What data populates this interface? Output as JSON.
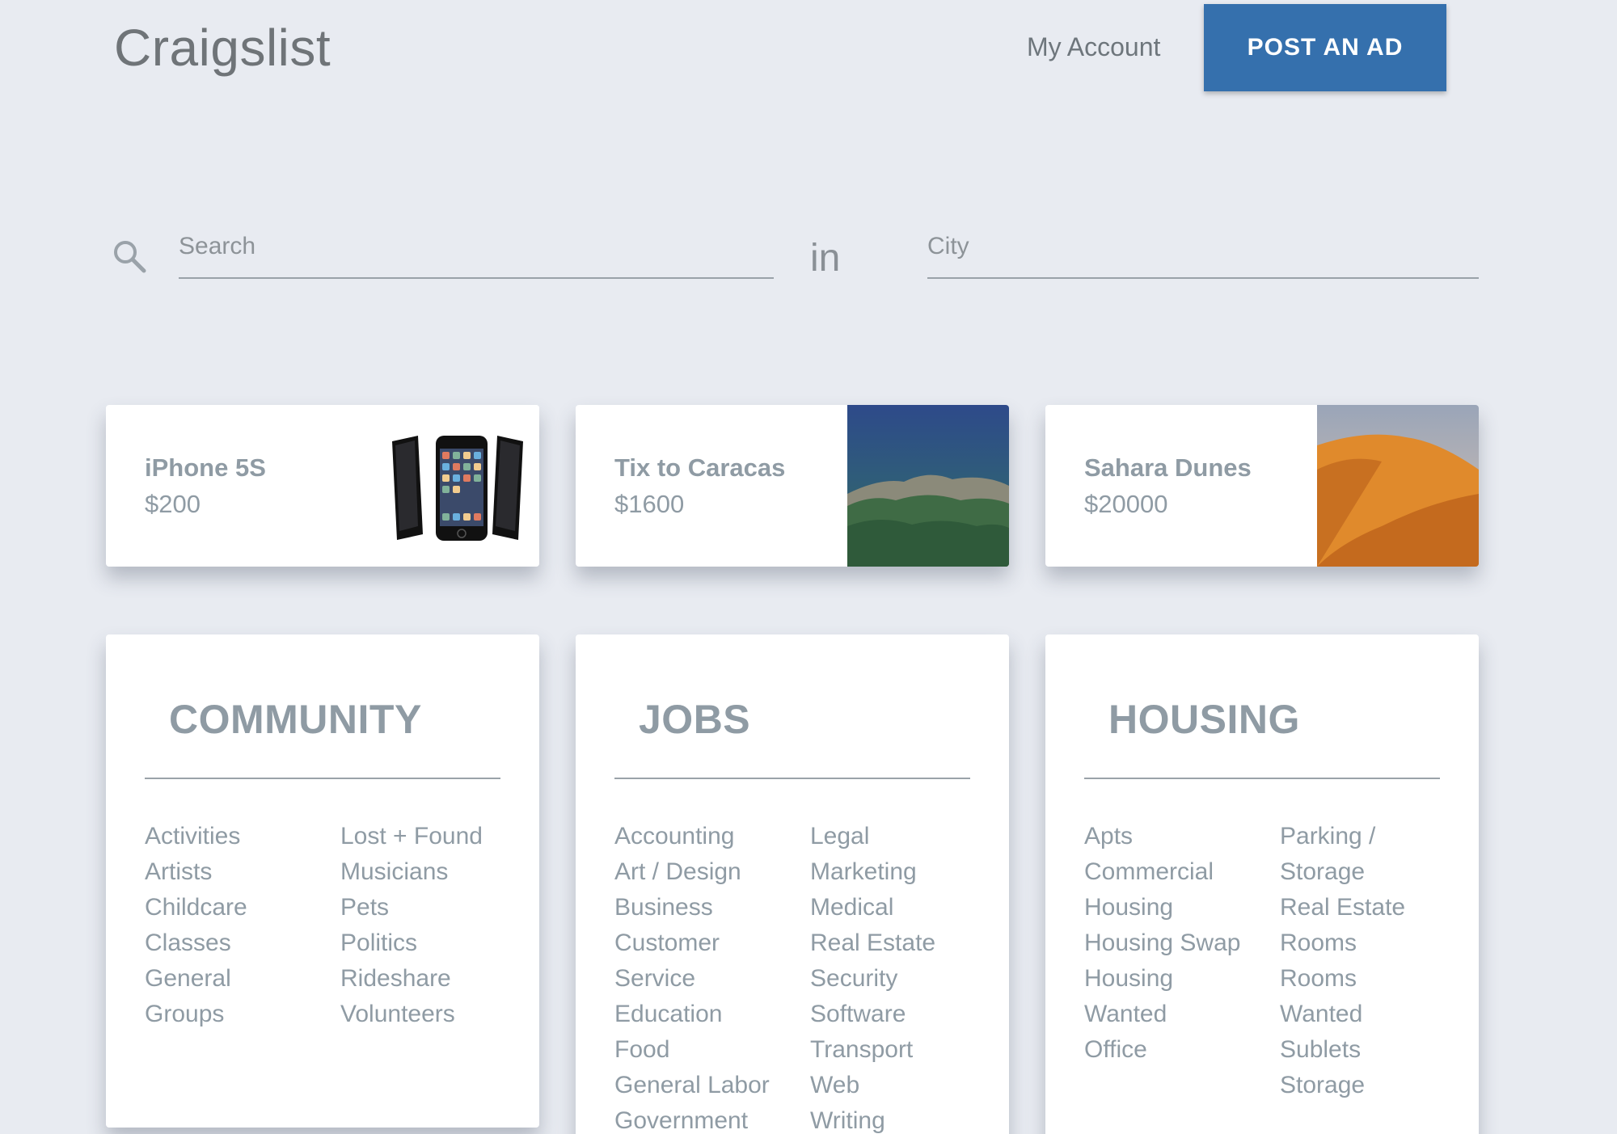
{
  "header": {
    "logo": "Craigslist",
    "my_account": "My Account",
    "post_ad": "POST AN AD"
  },
  "search": {
    "placeholder": "Search",
    "in_label": "in",
    "city_placeholder": "City"
  },
  "featured": [
    {
      "title": "iPhone 5S",
      "price": "$200",
      "image": "phone-image"
    },
    {
      "title": "Tix to Caracas",
      "price": "$1600",
      "image": "mountain-image"
    },
    {
      "title": "Sahara Dunes",
      "price": "$20000",
      "image": "dune-image"
    }
  ],
  "categories": [
    {
      "title": "COMMUNITY",
      "col1": [
        "Activities",
        "Artists",
        "Childcare",
        "Classes",
        "General",
        "Groups"
      ],
      "col2": [
        "Lost + Found",
        "Musicians",
        "Pets",
        "Politics",
        "Rideshare",
        "Volunteers"
      ]
    },
    {
      "title": "JOBS",
      "col1": [
        "Accounting",
        "Art / Design",
        "Business",
        "Customer",
        "Service",
        "Education",
        "Food",
        "General Labor",
        "Government"
      ],
      "col2": [
        "Legal",
        "Marketing",
        "Medical",
        "Real Estate",
        "Security",
        "Software",
        "Transport",
        "Web",
        "Writing"
      ]
    },
    {
      "title": "HOUSING",
      "col1": [
        "Apts",
        "Commercial",
        "Housing",
        "Housing Swap",
        "Housing",
        "Wanted",
        "Office"
      ],
      "col2": [
        "Parking /",
        "Storage",
        "Real Estate",
        "Rooms",
        "Rooms",
        "Wanted",
        "Sublets",
        "Storage"
      ]
    }
  ],
  "colors": {
    "background": "#e8ebf1",
    "accent": "#3570ad",
    "text": "#8f9ba4"
  }
}
